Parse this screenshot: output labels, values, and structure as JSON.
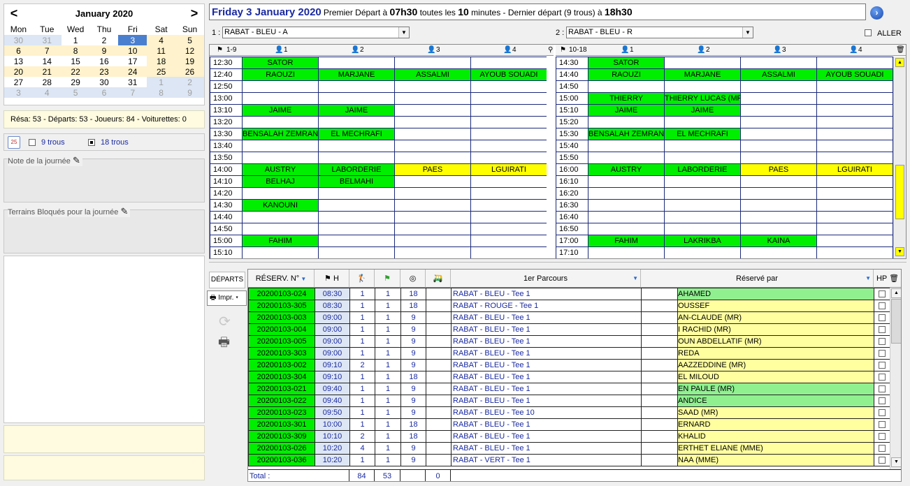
{
  "calendar": {
    "month": "January 2020",
    "prev": "<",
    "next": ">",
    "days": [
      "Mon",
      "Tue",
      "Wed",
      "Thu",
      "Fri",
      "Sat",
      "Sun"
    ],
    "weeks": [
      [
        [
          "30",
          "o"
        ],
        [
          "31",
          "o"
        ],
        [
          "1",
          "w"
        ],
        [
          "2",
          "w"
        ],
        [
          "3",
          "s"
        ],
        [
          "4",
          "e"
        ],
        [
          "5",
          "e"
        ]
      ],
      [
        [
          "6",
          "e"
        ],
        [
          "7",
          "e"
        ],
        [
          "8",
          "e"
        ],
        [
          "9",
          "e"
        ],
        [
          "10",
          "e"
        ],
        [
          "11",
          "e"
        ],
        [
          "12",
          "e"
        ]
      ],
      [
        [
          "13",
          "w"
        ],
        [
          "14",
          "w"
        ],
        [
          "15",
          "w"
        ],
        [
          "16",
          "w"
        ],
        [
          "17",
          "w"
        ],
        [
          "18",
          "e"
        ],
        [
          "19",
          "e"
        ]
      ],
      [
        [
          "20",
          "e"
        ],
        [
          "21",
          "e"
        ],
        [
          "22",
          "e"
        ],
        [
          "23",
          "e"
        ],
        [
          "24",
          "e"
        ],
        [
          "25",
          "e"
        ],
        [
          "26",
          "e"
        ]
      ],
      [
        [
          "27",
          "w"
        ],
        [
          "28",
          "w"
        ],
        [
          "29",
          "w"
        ],
        [
          "30",
          "w"
        ],
        [
          "31",
          "w"
        ],
        [
          "1",
          "o"
        ],
        [
          "2",
          "o"
        ]
      ],
      [
        [
          "3",
          "o"
        ],
        [
          "4",
          "o"
        ],
        [
          "5",
          "o"
        ],
        [
          "6",
          "o"
        ],
        [
          "7",
          "o"
        ],
        [
          "8",
          "o"
        ],
        [
          "9",
          "o"
        ]
      ]
    ]
  },
  "stats": "Résa: 53 - Départs: 53 - Joueurs: 84 - Voiturettes: 0",
  "holes": {
    "icon_text": "25",
    "nine": "9 trous",
    "eighteen": "18 trous"
  },
  "note_label": "Note de la journée",
  "blocked_label": "Terrains Bloqués pour la journée",
  "header": {
    "date": "Friday 3 January 2020",
    "t1": "Premier Départ à ",
    "v1": "07h30",
    "t2": " toutes les ",
    "v2": "10",
    "t3": " minutes - Dernier départ (9 trous) à ",
    "v3": "18h30"
  },
  "course1": {
    "label": "1 :",
    "value": "RABAT - BLEU - A"
  },
  "course2": {
    "label": "2 :",
    "value": "RABAT - BLEU - R"
  },
  "aller": "ALLER",
  "sheet": {
    "left_label": "1-9",
    "right_label": "10-18",
    "player_cols": [
      "1",
      "2",
      "3",
      "4"
    ],
    "left": [
      [
        "12:30",
        [
          "SATOR",
          "g"
        ],
        [
          "",
          ""
        ],
        [
          "",
          ""
        ],
        [
          "",
          ""
        ]
      ],
      [
        "12:40",
        [
          "RAOUZI",
          "g"
        ],
        [
          "MARJANE",
          "g"
        ],
        [
          "ASSALMI",
          "g"
        ],
        [
          "AYOUB SOUADI",
          "g"
        ]
      ],
      [
        "12:50",
        [
          "",
          ""
        ],
        [
          "",
          ""
        ],
        [
          "",
          ""
        ],
        [
          "",
          ""
        ]
      ],
      [
        "13:00",
        [
          "",
          ""
        ],
        [
          "",
          ""
        ],
        [
          "",
          ""
        ],
        [
          "",
          ""
        ]
      ],
      [
        "13:10",
        [
          "JAIME",
          "g"
        ],
        [
          "JAIME",
          "g"
        ],
        [
          "",
          ""
        ],
        [
          "",
          ""
        ]
      ],
      [
        "13:20",
        [
          "",
          ""
        ],
        [
          "",
          ""
        ],
        [
          "",
          ""
        ],
        [
          "",
          ""
        ]
      ],
      [
        "13:30",
        [
          "BENSALAH ZEMRANI",
          "g"
        ],
        [
          "EL MECHRAFI",
          "g"
        ],
        [
          "",
          ""
        ],
        [
          "",
          ""
        ]
      ],
      [
        "13:40",
        [
          "",
          ""
        ],
        [
          "",
          ""
        ],
        [
          "",
          ""
        ],
        [
          "",
          ""
        ]
      ],
      [
        "13:50",
        [
          "",
          ""
        ],
        [
          "",
          ""
        ],
        [
          "",
          ""
        ],
        [
          "",
          ""
        ]
      ],
      [
        "14:00",
        [
          "AUSTRY",
          "g"
        ],
        [
          "LABORDERIE",
          "g"
        ],
        [
          "PAES",
          "y"
        ],
        [
          "LGUIRATI",
          "y"
        ]
      ],
      [
        "14:10",
        [
          "BELHAJ",
          "g"
        ],
        [
          "BELMAHI",
          "g"
        ],
        [
          "",
          ""
        ],
        [
          "",
          ""
        ]
      ],
      [
        "14:20",
        [
          "",
          ""
        ],
        [
          "",
          ""
        ],
        [
          "",
          ""
        ],
        [
          "",
          ""
        ]
      ],
      [
        "14:30",
        [
          "KANOUNI",
          "g"
        ],
        [
          "",
          ""
        ],
        [
          "",
          ""
        ],
        [
          "",
          ""
        ]
      ],
      [
        "14:40",
        [
          "",
          ""
        ],
        [
          "",
          ""
        ],
        [
          "",
          ""
        ],
        [
          "",
          ""
        ]
      ],
      [
        "14:50",
        [
          "",
          ""
        ],
        [
          "",
          ""
        ],
        [
          "",
          ""
        ],
        [
          "",
          ""
        ]
      ],
      [
        "15:00",
        [
          "FAHIM",
          "g"
        ],
        [
          "",
          ""
        ],
        [
          "",
          ""
        ],
        [
          "",
          ""
        ]
      ],
      [
        "15:10",
        [
          "",
          ""
        ],
        [
          "",
          ""
        ],
        [
          "",
          ""
        ],
        [
          "",
          ""
        ]
      ]
    ],
    "right": [
      [
        "14:30",
        [
          "SATOR",
          "g"
        ],
        [
          "",
          ""
        ],
        [
          "",
          ""
        ],
        [
          "",
          ""
        ]
      ],
      [
        "14:40",
        [
          "RAOUZI",
          "g"
        ],
        [
          "MARJANE",
          "g"
        ],
        [
          "ASSALMI",
          "g"
        ],
        [
          "AYOUB SOUADI",
          "g"
        ]
      ],
      [
        "14:50",
        [
          "",
          ""
        ],
        [
          "",
          ""
        ],
        [
          "",
          ""
        ],
        [
          "",
          ""
        ]
      ],
      [
        "15:00",
        [
          "THIERRY",
          "g"
        ],
        [
          "THIERRY LUCAS (MR)",
          "g"
        ],
        [
          "",
          ""
        ],
        [
          "",
          ""
        ]
      ],
      [
        "15:10",
        [
          "JAIME",
          "g"
        ],
        [
          "JAIME",
          "g"
        ],
        [
          "",
          ""
        ],
        [
          "",
          ""
        ]
      ],
      [
        "15:20",
        [
          "",
          ""
        ],
        [
          "",
          ""
        ],
        [
          "",
          ""
        ],
        [
          "",
          ""
        ]
      ],
      [
        "15:30",
        [
          "BENSALAH ZEMRANI",
          "g"
        ],
        [
          "EL MECHRAFI",
          "g"
        ],
        [
          "",
          ""
        ],
        [
          "",
          ""
        ]
      ],
      [
        "15:40",
        [
          "",
          ""
        ],
        [
          "",
          ""
        ],
        [
          "",
          ""
        ],
        [
          "",
          ""
        ]
      ],
      [
        "15:50",
        [
          "",
          ""
        ],
        [
          "",
          ""
        ],
        [
          "",
          ""
        ],
        [
          "",
          ""
        ]
      ],
      [
        "16:00",
        [
          "AUSTRY",
          "g"
        ],
        [
          "LABORDERIE",
          "g"
        ],
        [
          "PAES",
          "y"
        ],
        [
          "LGUIRATI",
          "y"
        ]
      ],
      [
        "16:10",
        [
          "",
          ""
        ],
        [
          "",
          ""
        ],
        [
          "",
          ""
        ],
        [
          "",
          ""
        ]
      ],
      [
        "16:20",
        [
          "",
          ""
        ],
        [
          "",
          ""
        ],
        [
          "",
          ""
        ],
        [
          "",
          ""
        ]
      ],
      [
        "16:30",
        [
          "",
          ""
        ],
        [
          "",
          ""
        ],
        [
          "",
          ""
        ],
        [
          "",
          ""
        ]
      ],
      [
        "16:40",
        [
          "",
          ""
        ],
        [
          "",
          ""
        ],
        [
          "",
          ""
        ],
        [
          "",
          ""
        ]
      ],
      [
        "16:50",
        [
          "",
          ""
        ],
        [
          "",
          ""
        ],
        [
          "",
          ""
        ],
        [
          "",
          ""
        ]
      ],
      [
        "17:00",
        [
          "FAHIM",
          "g"
        ],
        [
          "LAKRIKBA",
          "g"
        ],
        [
          "KAINA",
          "g"
        ],
        [
          "",
          ""
        ]
      ],
      [
        "17:10",
        [
          "",
          ""
        ],
        [
          "",
          ""
        ],
        [
          "",
          ""
        ],
        [
          "",
          ""
        ]
      ]
    ]
  },
  "departs": {
    "tab": "DÉPARTS",
    "print": "Impr.",
    "headers": {
      "resv": "RÉSERV. N°",
      "h": "H",
      "parcours": "1er Parcours",
      "reserve": "Réservé par",
      "hp": "HP"
    },
    "rows": [
      [
        "20200103-024",
        "08:30",
        "1",
        "1",
        "18",
        "RABAT - BLEU - Tee 1",
        "AHAMED",
        "g"
      ],
      [
        "20200103-305",
        "08:30",
        "1",
        "1",
        "18",
        "RABAT - ROUGE - Tee 1",
        "OUSSEF",
        "y"
      ],
      [
        "20200103-003",
        "09:00",
        "1",
        "1",
        "9",
        "RABAT - BLEU - Tee 1",
        "AN-CLAUDE (MR)",
        "y"
      ],
      [
        "20200103-004",
        "09:00",
        "1",
        "1",
        "9",
        "RABAT - BLEU - Tee 1",
        "I RACHID (MR)",
        "y"
      ],
      [
        "20200103-005",
        "09:00",
        "1",
        "1",
        "9",
        "RABAT - BLEU - Tee 1",
        "OUN ABDELLATIF (MR)",
        "y"
      ],
      [
        "20200103-303",
        "09:00",
        "1",
        "1",
        "9",
        "RABAT - BLEU - Tee 1",
        "REDA",
        "y"
      ],
      [
        "20200103-002",
        "09:10",
        "2",
        "1",
        "9",
        "RABAT - BLEU - Tee 1",
        "AAZZEDDINE (MR)",
        "y"
      ],
      [
        "20200103-304",
        "09:10",
        "1",
        "1",
        "18",
        "RABAT - BLEU - Tee 1",
        "EL MILOUD",
        "y"
      ],
      [
        "20200103-021",
        "09:40",
        "1",
        "1",
        "9",
        "RABAT - BLEU - Tee 1",
        "EN PAULE (MR)",
        "g"
      ],
      [
        "20200103-022",
        "09:40",
        "1",
        "1",
        "9",
        "RABAT - BLEU - Tee 1",
        "ANDICE",
        "g"
      ],
      [
        "20200103-023",
        "09:50",
        "1",
        "1",
        "9",
        "RABAT - BLEU - Tee 10",
        "SAAD (MR)",
        "y"
      ],
      [
        "20200103-301",
        "10:00",
        "1",
        "1",
        "18",
        "RABAT - BLEU - Tee 1",
        "ERNARD",
        "y"
      ],
      [
        "20200103-309",
        "10:10",
        "2",
        "1",
        "18",
        "RABAT - BLEU - Tee 1",
        "KHALID",
        "y"
      ],
      [
        "20200103-026",
        "10:20",
        "4",
        "1",
        "9",
        "RABAT - BLEU - Tee 1",
        "ERTHET ELIANE (MME)",
        "y"
      ],
      [
        "20200103-036",
        "10:20",
        "1",
        "1",
        "9",
        "RABAT - VERT - Tee 1",
        "NAA (MME)",
        "y"
      ]
    ],
    "total": {
      "label": "Total :",
      "players": "84",
      "departs": "53",
      "carts": "0"
    }
  }
}
